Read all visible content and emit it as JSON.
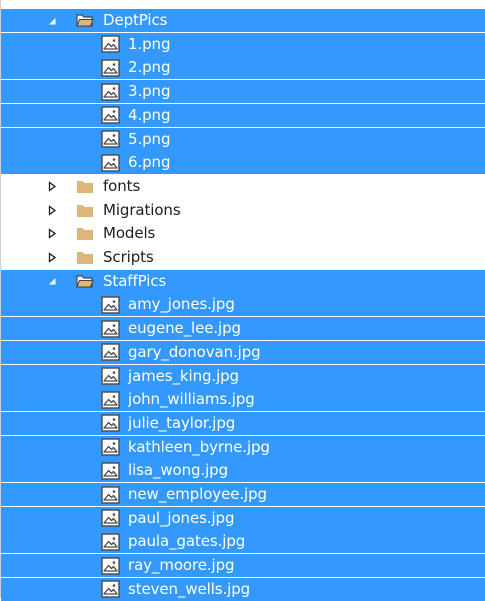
{
  "tree": [
    {
      "type": "folder",
      "state": "expanded",
      "selected": true,
      "label": "DeptPics",
      "icon": "folder-open-icon"
    },
    {
      "type": "file",
      "selected": true,
      "label": "1.png",
      "icon": "image-file-icon"
    },
    {
      "type": "file",
      "selected": true,
      "label": "2.png",
      "icon": "image-file-icon"
    },
    {
      "type": "file",
      "selected": true,
      "label": "3.png",
      "icon": "image-file-icon"
    },
    {
      "type": "file",
      "selected": true,
      "label": "4.png",
      "icon": "image-file-icon"
    },
    {
      "type": "file",
      "selected": true,
      "label": "5.png",
      "icon": "image-file-icon"
    },
    {
      "type": "file",
      "selected": true,
      "label": "6.png",
      "icon": "image-file-icon"
    },
    {
      "type": "folder",
      "state": "collapsed",
      "selected": false,
      "label": "fonts",
      "icon": "folder-icon"
    },
    {
      "type": "folder",
      "state": "collapsed",
      "selected": false,
      "label": "Migrations",
      "icon": "folder-icon"
    },
    {
      "type": "folder",
      "state": "collapsed",
      "selected": false,
      "label": "Models",
      "icon": "folder-icon"
    },
    {
      "type": "folder",
      "state": "collapsed",
      "selected": false,
      "label": "Scripts",
      "icon": "folder-icon"
    },
    {
      "type": "folder",
      "state": "expanded",
      "selected": true,
      "label": "StaffPics",
      "icon": "folder-open-icon"
    },
    {
      "type": "file",
      "selected": true,
      "label": "amy_jones.jpg",
      "icon": "image-file-icon"
    },
    {
      "type": "file",
      "selected": true,
      "label": "eugene_lee.jpg",
      "icon": "image-file-icon"
    },
    {
      "type": "file",
      "selected": true,
      "label": "gary_donovan.jpg",
      "icon": "image-file-icon"
    },
    {
      "type": "file",
      "selected": true,
      "label": "james_king.jpg",
      "icon": "image-file-icon"
    },
    {
      "type": "file",
      "selected": true,
      "label": "john_williams.jpg",
      "icon": "image-file-icon"
    },
    {
      "type": "file",
      "selected": true,
      "label": "julie_taylor.jpg",
      "icon": "image-file-icon"
    },
    {
      "type": "file",
      "selected": true,
      "label": "kathleen_byrne.jpg",
      "icon": "image-file-icon"
    },
    {
      "type": "file",
      "selected": true,
      "label": "lisa_wong.jpg",
      "icon": "image-file-icon"
    },
    {
      "type": "file",
      "selected": true,
      "label": "new_employee.jpg",
      "icon": "image-file-icon"
    },
    {
      "type": "file",
      "selected": true,
      "label": "paul_jones.jpg",
      "icon": "image-file-icon"
    },
    {
      "type": "file",
      "selected": true,
      "label": "paula_gates.jpg",
      "icon": "image-file-icon"
    },
    {
      "type": "file",
      "selected": true,
      "label": "ray_moore.jpg",
      "icon": "image-file-icon"
    },
    {
      "type": "file",
      "selected": true,
      "label": "steven_wells.jpg",
      "icon": "image-file-icon"
    }
  ],
  "colors": {
    "selection": "#3399ff",
    "selected_text": "#ffffff",
    "text": "#1e1e1e",
    "folder": "#dcb67a"
  }
}
